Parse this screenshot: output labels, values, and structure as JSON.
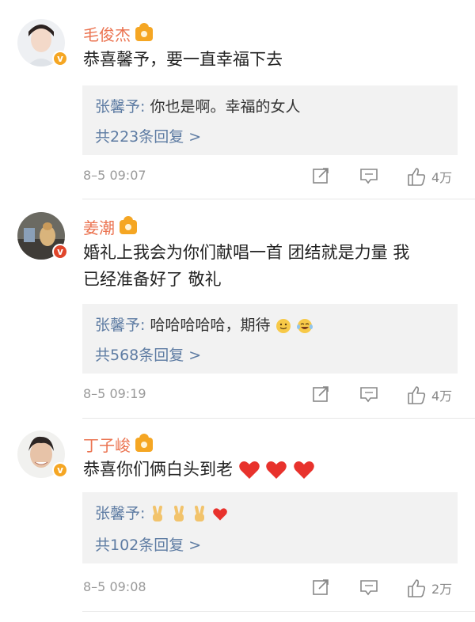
{
  "comments": [
    {
      "name": "毛俊杰",
      "text": "恭喜馨予，要一直幸福下去",
      "reply_author": "张馨予:",
      "reply_text": " 你也是啊。幸福的女人",
      "reply_count": "共223条回复 >",
      "time": "8–5 09:07",
      "likes": "4万"
    },
    {
      "name": "姜潮",
      "text_line1": "婚礼上我会为你们献唱一首 团结就是力量 我",
      "text_line2": "已经准备好了 敬礼",
      "reply_author": "张馨予:",
      "reply_text": " 哈哈哈哈哈，期待",
      "reply_count": "共568条回复 >",
      "time": "8–5 09:19",
      "likes": "4万"
    },
    {
      "name": "丁子峻",
      "text": "恭喜你们俩白头到老",
      "reply_author": "张馨予:",
      "reply_count": "共102条回复 >",
      "time": "8–5 09:08",
      "likes": "2万"
    }
  ],
  "colors": {
    "name": "#eb7350",
    "link": "#5e7ca3",
    "reply_bg": "#f2f2f2",
    "heart": "#e8322c"
  },
  "icons": [
    "share-icon",
    "comment-icon",
    "like-icon",
    "verified-badge-icon",
    "vip-crown-icon",
    "heart-icon",
    "smile-emoji",
    "laugh-cry-emoji",
    "victory-hand-emoji"
  ]
}
